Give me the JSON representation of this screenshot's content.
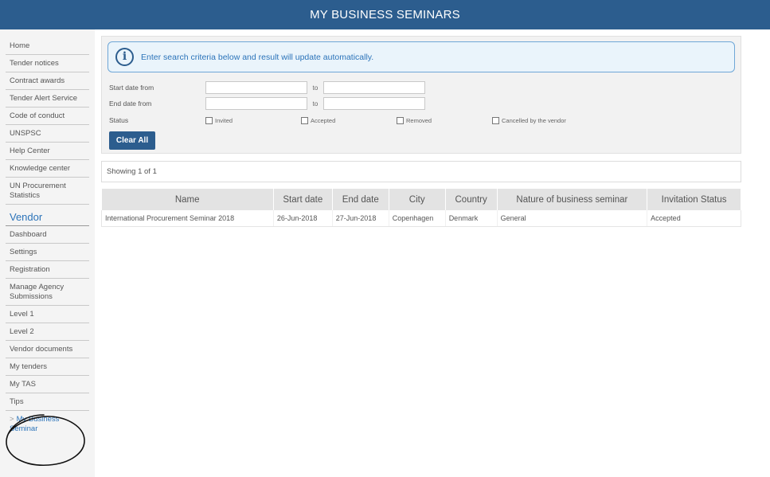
{
  "header": {
    "title": "MY BUSINESS SEMINARS"
  },
  "sidebar": {
    "items": [
      {
        "label": "Home"
      },
      {
        "label": "Tender notices"
      },
      {
        "label": "Contract awards"
      },
      {
        "label": "Tender Alert Service"
      },
      {
        "label": "Code of conduct"
      },
      {
        "label": "UNSPSC"
      },
      {
        "label": "Help Center"
      },
      {
        "label": "Knowledge center"
      },
      {
        "label": "UN Procurement Statistics"
      }
    ],
    "section_title": "Vendor",
    "vendor_items": [
      {
        "label": "Dashboard"
      },
      {
        "label": "Settings"
      },
      {
        "label": "Registration"
      },
      {
        "label": "Manage Agency Submissions"
      },
      {
        "label": "Level 1"
      },
      {
        "label": "Level 2"
      },
      {
        "label": "Vendor documents"
      },
      {
        "label": "My tenders"
      },
      {
        "label": "My TAS"
      },
      {
        "label": "Tips"
      }
    ],
    "active_item": {
      "chevron": ">",
      "label": "My Business Seminar"
    }
  },
  "search": {
    "info_text": "Enter search criteria below and result will update automatically.",
    "start_label": "Start date from",
    "end_label": "End date from",
    "to_label": "to",
    "start_from": "",
    "start_to": "",
    "end_from": "",
    "end_to": "",
    "status_label": "Status",
    "status_options": [
      {
        "label": "Invited",
        "checked": false
      },
      {
        "label": "Accepted",
        "checked": false
      },
      {
        "label": "Removed",
        "checked": false
      },
      {
        "label": "Cancelled by the vendor",
        "checked": false
      }
    ],
    "clear_label": "Clear All"
  },
  "results": {
    "showing": "Showing 1 of 1",
    "columns": [
      "Name",
      "Start date",
      "End date",
      "City",
      "Country",
      "Nature of business seminar",
      "Invitation Status"
    ],
    "rows": [
      [
        "International Procurement Seminar 2018",
        "26-Jun-2018",
        "27-Jun-2018",
        "Copenhagen",
        "Denmark",
        "General",
        "Accepted"
      ]
    ]
  },
  "colors": {
    "header_bg": "#2c5d8e",
    "link": "#2b73b9",
    "annotation": "#111111"
  }
}
